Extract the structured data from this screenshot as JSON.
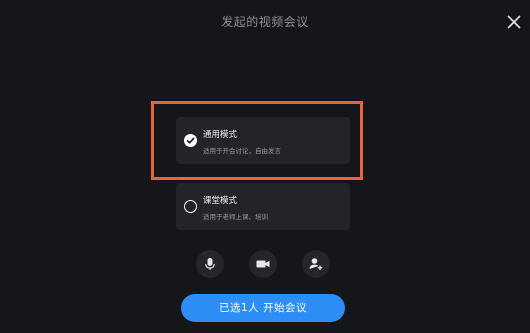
{
  "window": {
    "title": "发起的视频会议"
  },
  "modes": [
    {
      "title": "通用模式",
      "description": "适用于开会讨论，自由发言",
      "selected": true
    },
    {
      "title": "课堂模式",
      "description": "适用于老师上课、培训",
      "selected": false
    }
  ],
  "controls": [
    {
      "icon": "microphone-icon"
    },
    {
      "icon": "camera-icon"
    },
    {
      "icon": "add-participant-icon"
    }
  ],
  "actions": {
    "start_label": "已选1人  开始会议"
  },
  "colors": {
    "background": "#151619",
    "card": "#222428",
    "accent": "#2c8ef6",
    "highlight_border": "#e9643d"
  }
}
